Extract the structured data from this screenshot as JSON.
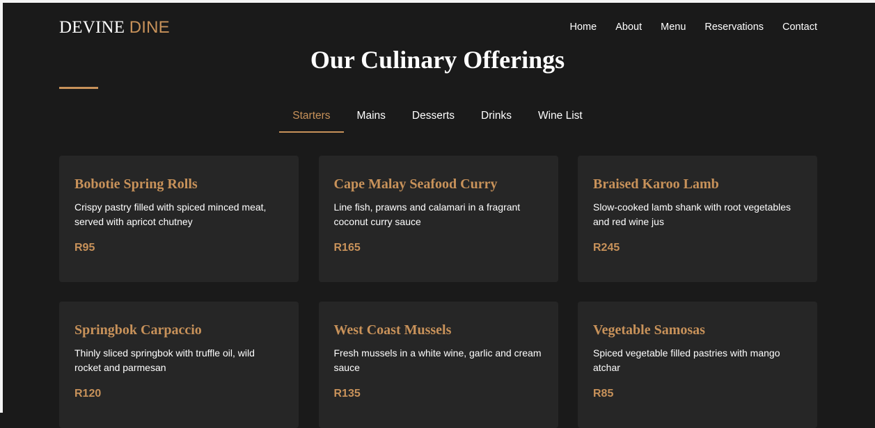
{
  "brand": {
    "name_a": "DEVINE",
    "name_b": "DINE"
  },
  "nav": [
    "Home",
    "About",
    "Menu",
    "Reservations",
    "Contact"
  ],
  "section": {
    "title": "Our Culinary Offerings"
  },
  "tabs": [
    "Starters",
    "Mains",
    "Desserts",
    "Drinks",
    "Wine List"
  ],
  "active_tab": "Starters",
  "items": [
    {
      "name": "Bobotie Spring Rolls",
      "desc": "Crispy pastry filled with spiced minced meat, served with apricot chutney",
      "price": "R95"
    },
    {
      "name": "Cape Malay Seafood Curry",
      "desc": "Line fish, prawns and calamari in a fragrant coconut curry sauce",
      "price": "R165"
    },
    {
      "name": "Braised Karoo Lamb",
      "desc": "Slow-cooked lamb shank with root vegetables and red wine jus",
      "price": "R245"
    },
    {
      "name": "Springbok Carpaccio",
      "desc": "Thinly sliced springbok with truffle oil, wild rocket and parmesan",
      "price": "R120"
    },
    {
      "name": "West Coast Mussels",
      "desc": "Fresh mussels in a white wine, garlic and cream sauce",
      "price": "R135"
    },
    {
      "name": "Vegetable Samosas",
      "desc": "Spiced vegetable filled pastries with mango atchar",
      "price": "R85"
    }
  ],
  "colors": {
    "background": "#1a1a1a",
    "card": "#262626",
    "accent": "#c8925a",
    "text": "#ffffff"
  }
}
